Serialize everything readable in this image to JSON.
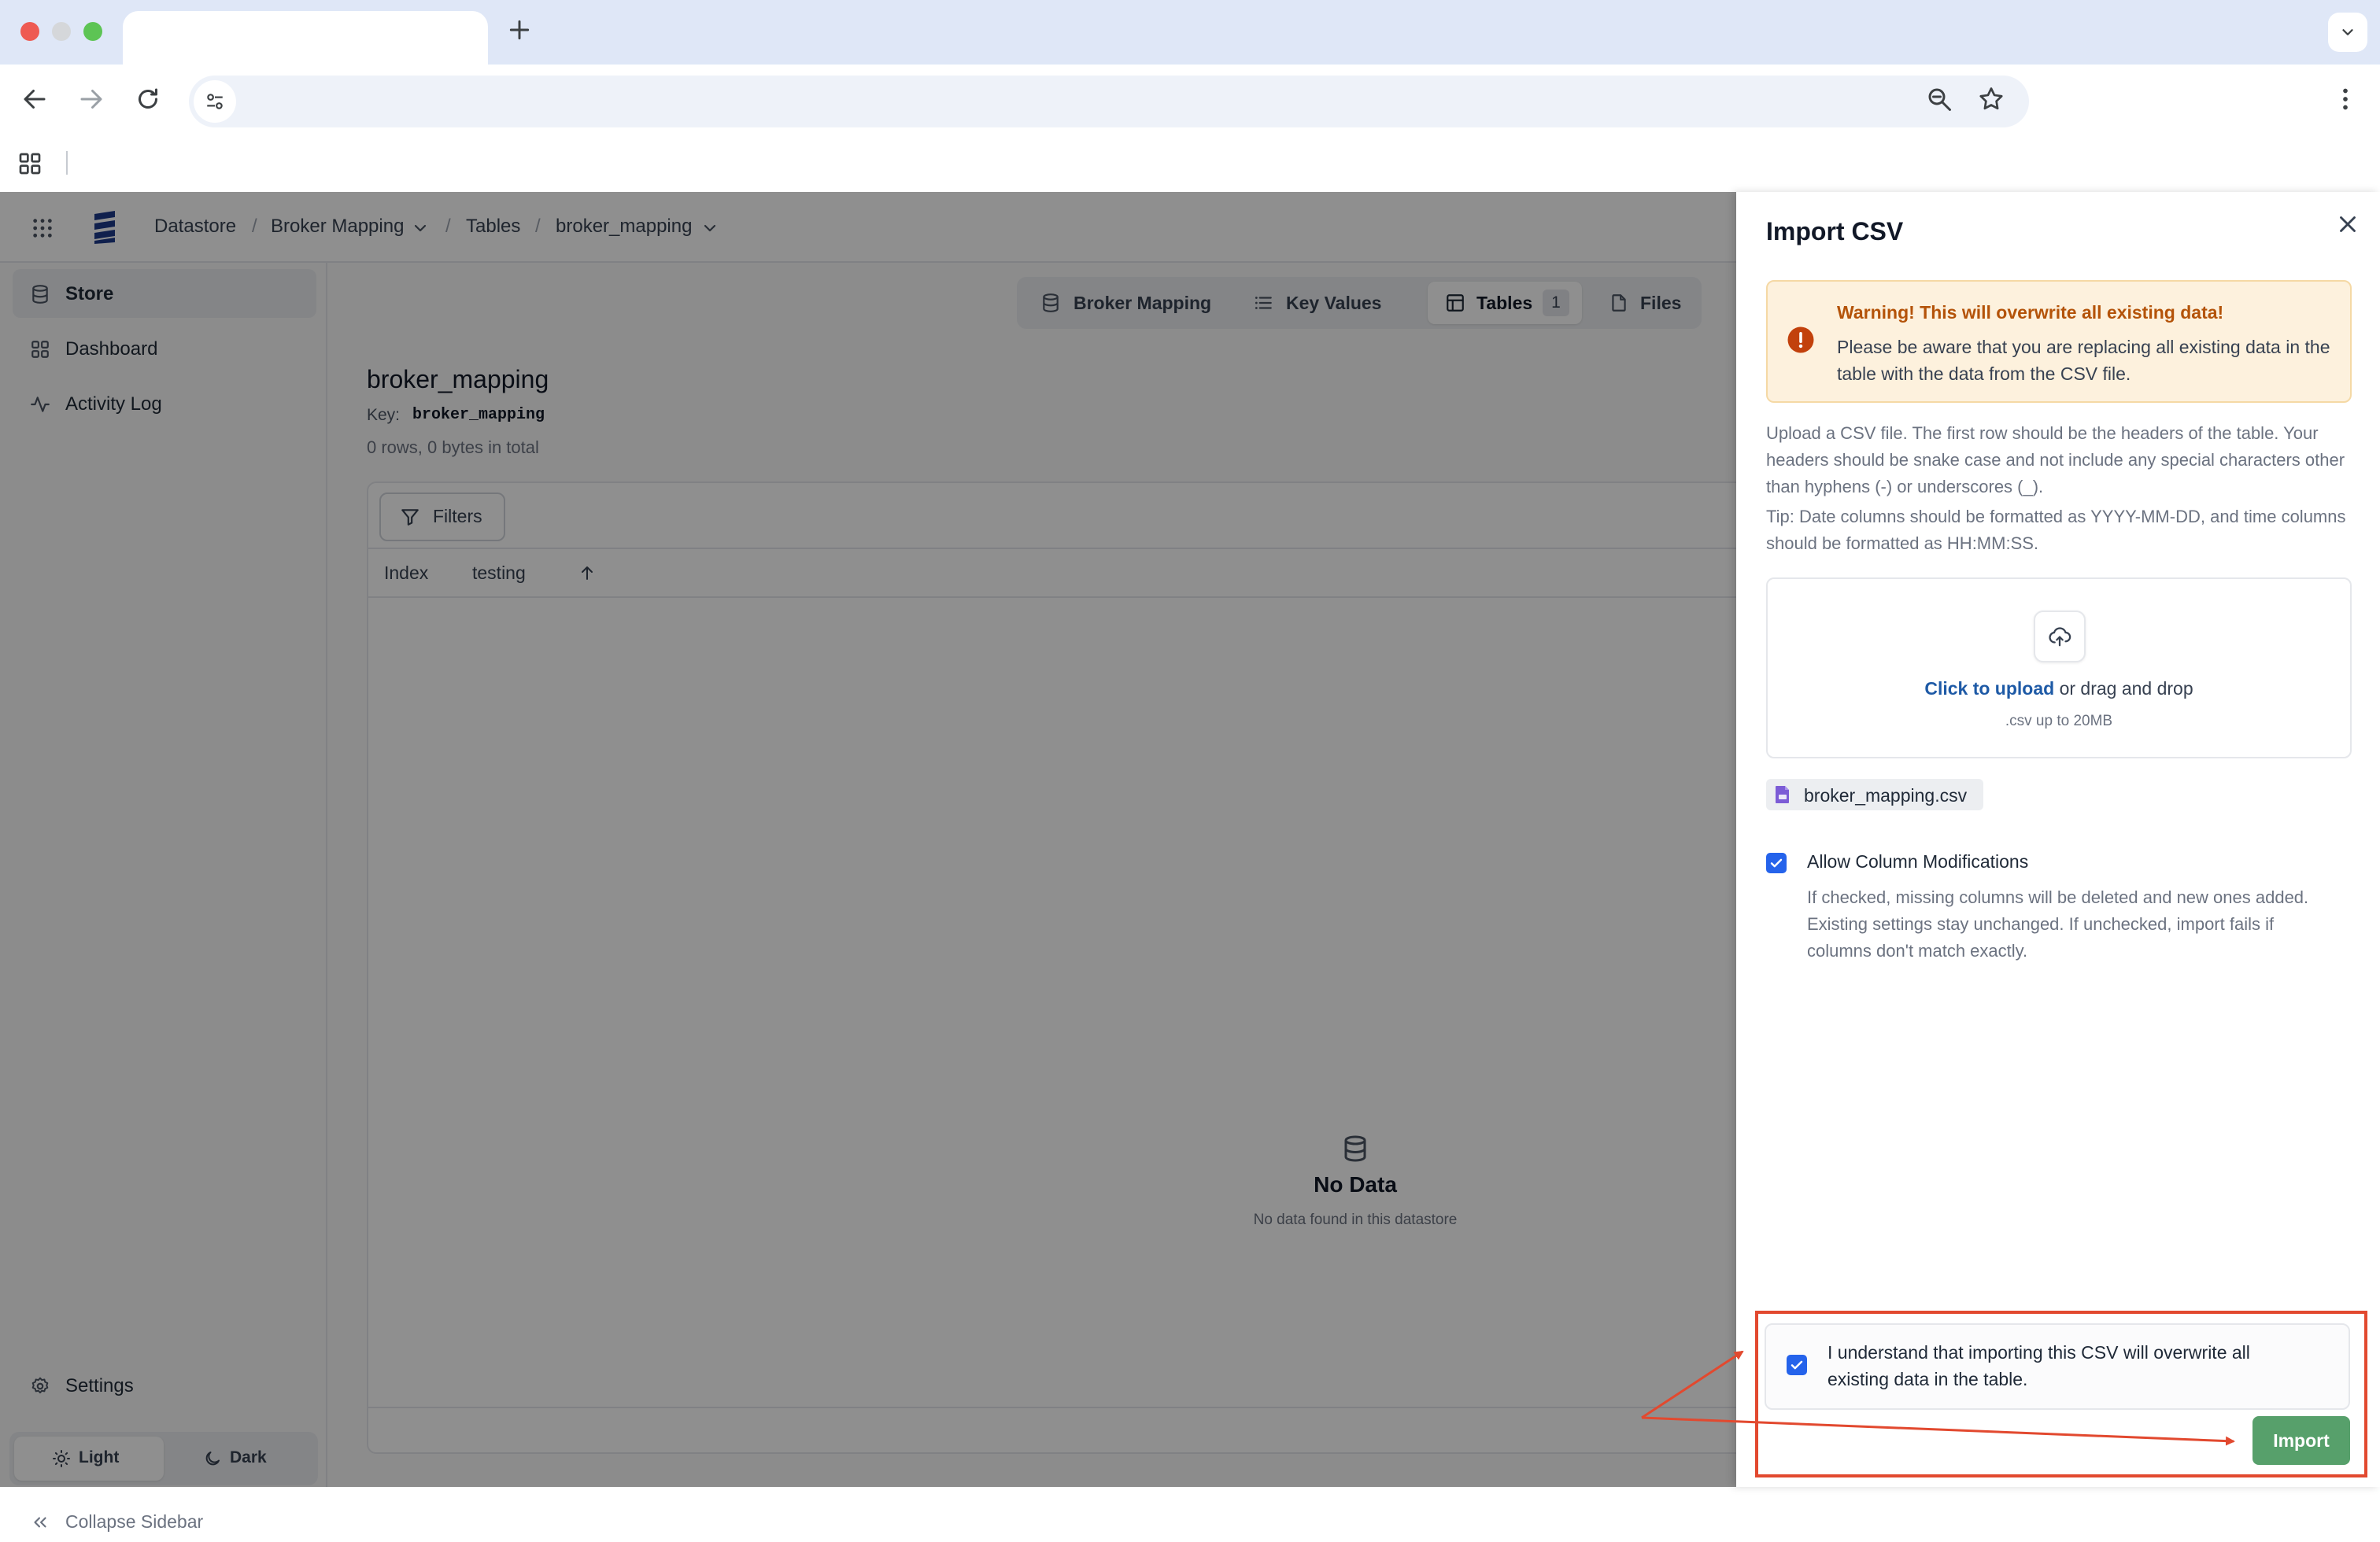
{
  "breadcrumb": {
    "items": [
      "Datastore",
      "Broker Mapping",
      "Tables",
      "broker_mapping"
    ],
    "separator": "/"
  },
  "sidebar": {
    "items": [
      {
        "label": "Store",
        "icon": "database-icon"
      },
      {
        "label": "Dashboard",
        "icon": "dashboard-grid-icon"
      },
      {
        "label": "Activity Log",
        "icon": "activity-icon"
      }
    ],
    "settings_label": "Settings",
    "theme": {
      "light": "Light",
      "dark": "Dark",
      "selected": "Light"
    },
    "collapse_label": "Collapse Sidebar"
  },
  "tabs": [
    {
      "label": "Broker Mapping",
      "icon": "database-icon"
    },
    {
      "label": "Key Values",
      "icon": "list-icon"
    },
    {
      "label": "Tables",
      "icon": "table-icon",
      "count": "1",
      "selected": true
    },
    {
      "label": "Files",
      "icon": "file-icon"
    }
  ],
  "table_info": {
    "title": "broker_mapping",
    "key_label": "Key:",
    "key_value": "broker_mapping",
    "summary": "0 rows, 0 bytes in total"
  },
  "table": {
    "filters_label": "Filters",
    "columns": [
      "Index",
      "testing"
    ],
    "empty_title": "No Data",
    "empty_subtitle": "No data found in this datastore"
  },
  "drawer": {
    "title": "Import CSV",
    "warning_title": "Warning! This will overwrite all existing data!",
    "warning_body": "Please be aware that you are replacing all existing data in the table with the data from the CSV file.",
    "instructions": "Upload a CSV file. The first row should be the headers of the table. Your headers should be snake case and not include any special characters other than hyphens (-) or underscores (_).",
    "tip": "Tip: Date columns should be formatted as YYYY-MM-DD, and time columns should be formatted as HH:MM:SS.",
    "upload_link": "Click to upload",
    "upload_rest": " or drag and drop",
    "upload_hint": ".csv up to 20MB",
    "file_name": "broker_mapping.csv",
    "allow_mod_label": "Allow Column Modifications",
    "allow_mod_checked": true,
    "allow_mod_desc": "If checked, missing columns will be deleted and new ones added. Existing settings stay unchanged. If unchecked, import fails if columns don't match exactly.",
    "confirm_label": "I understand that importing this CSV will overwrite all existing data in the table.",
    "confirm_checked": true,
    "import_label": "Import"
  },
  "colors": {
    "accent": "#2563eb",
    "import_button": "#57a06b",
    "warning_bg": "#fdf1dd",
    "warning_title": "#b45309",
    "annotation": "#e2492f",
    "link": "#1e5aa6"
  }
}
